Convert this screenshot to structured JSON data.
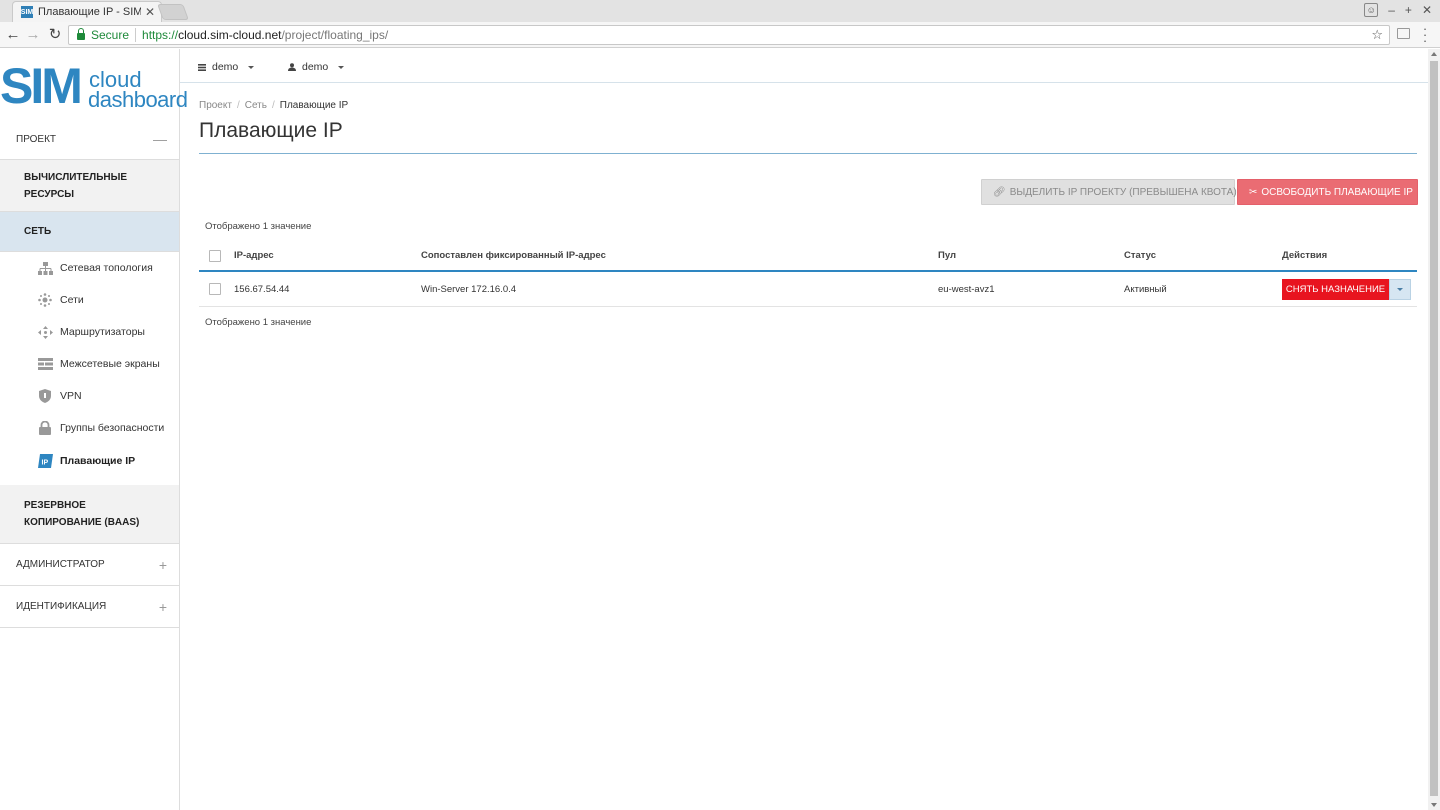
{
  "browser": {
    "tab_title": "Плавающие IP - SIM-N",
    "tab_close": "✕",
    "favicon_text": "SIM",
    "secure_label": "Secure",
    "url_scheme": "https://",
    "url_host": "cloud.sim-cloud.net",
    "url_path": "/project/floating_ips/",
    "win_controls": [
      "–",
      "+",
      "✕"
    ]
  },
  "logo": {
    "sim": "SIM",
    "cloud": "cloud",
    "dashboard": "dashboard"
  },
  "topbar": {
    "project_label": "demo",
    "user_label": "demo"
  },
  "sidebar": {
    "project": {
      "label": "ПРОЕКТ",
      "toggle": "—"
    },
    "groups": {
      "compute": "ВЫЧИСЛИТЕЛЬНЫЕ РЕСУРСЫ",
      "network": "СЕТЬ",
      "backup": "РЕЗЕРВНОЕ КОПИРОВАНИЕ (BAAS)"
    },
    "items": [
      {
        "label": "Сетевая топология",
        "icon": "network-topology-icon"
      },
      {
        "label": "Сети",
        "icon": "networks-icon"
      },
      {
        "label": "Маршрутизаторы",
        "icon": "routers-icon"
      },
      {
        "label": "Межсетевые экраны",
        "icon": "firewall-icon"
      },
      {
        "label": "VPN",
        "icon": "vpn-shield-icon"
      },
      {
        "label": "Группы безопасности",
        "icon": "lock-icon"
      },
      {
        "label": "Плавающие IP",
        "icon": "floating-ip-icon"
      }
    ],
    "admin": {
      "label": "АДМИНИСТРАТОР",
      "toggle": "+"
    },
    "identity": {
      "label": "ИДЕНТИФИКАЦИЯ",
      "toggle": "+"
    }
  },
  "breadcrumb": {
    "items": [
      "Проект",
      "Сеть"
    ],
    "current": "Плавающие IP",
    "sep": "/"
  },
  "page_title": "Плавающие IP",
  "actions": {
    "allocate": "ВЫДЕЛИТЬ IP ПРОЕКТУ (ПРЕВЫШЕНА КВОТА)",
    "release": "ОСВОБОДИТЬ ПЛАВАЮЩИЕ IP"
  },
  "table": {
    "count_text": "Отображено 1 значение",
    "columns": [
      "IP-адрес",
      "Сопоставлен фиксированный IP-адрес",
      "Пул",
      "Статус",
      "Действия"
    ],
    "rows": [
      {
        "ip": "156.67.54.44",
        "fixed_ip": "Win-Server 172.16.0.4",
        "pool": "eu-west-avz1",
        "status": "Активный",
        "action": "СНЯТЬ НАЗНАЧЕНИЕ"
      }
    ]
  },
  "colors": {
    "brand": "#2e86c1",
    "danger": "#e8141f",
    "danger_light": "#ea6c73",
    "active_group_bg": "#d9e5ef"
  }
}
